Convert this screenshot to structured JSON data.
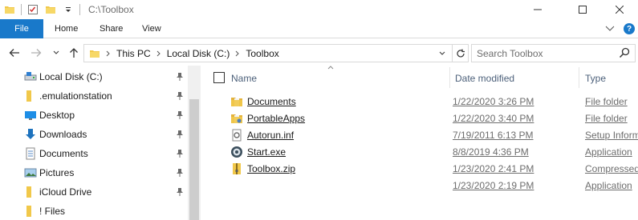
{
  "titlebar": {
    "title": "C:\\Toolbox"
  },
  "ribbon": {
    "file_tab": "File",
    "tabs": [
      "Home",
      "Share",
      "View"
    ],
    "help": "?"
  },
  "address": {
    "crumbs": [
      "This PC",
      "Local Disk (C:)",
      "Toolbox"
    ]
  },
  "search": {
    "placeholder": "Search Toolbox"
  },
  "navpane": {
    "items": [
      {
        "label": "Local Disk (C:)",
        "icon": "drive-icon",
        "pinned": true
      },
      {
        "label": ".emulationstation",
        "icon": "folder-icon",
        "pinned": true
      },
      {
        "label": "Desktop",
        "icon": "desktop-icon",
        "pinned": true
      },
      {
        "label": "Downloads",
        "icon": "downloads-icon",
        "pinned": true
      },
      {
        "label": "Documents",
        "icon": "documents-icon",
        "pinned": true
      },
      {
        "label": "Pictures",
        "icon": "pictures-icon",
        "pinned": true
      },
      {
        "label": "iCloud Drive",
        "icon": "folder-icon",
        "pinned": true
      },
      {
        "label": "! Files",
        "icon": "folder-icon",
        "pinned": false
      }
    ]
  },
  "filelist": {
    "columns": {
      "name": "Name",
      "date": "Date modified",
      "type": "Type"
    },
    "rows": [
      {
        "name": "Documents",
        "date": "1/22/2020 3:26 PM",
        "type": "File folder",
        "icon": "folder-icon"
      },
      {
        "name": "PortableApps",
        "date": "1/22/2020 3:40 PM",
        "type": "File folder",
        "icon": "folder-icon"
      },
      {
        "name": "Autorun.inf",
        "date": "7/19/2011 6:13 PM",
        "type": "Setup Inform",
        "icon": "setup-file-icon"
      },
      {
        "name": "Start.exe",
        "date": "8/8/2019 4:36 PM",
        "type": "Application",
        "icon": "app-icon"
      },
      {
        "name": "Toolbox.zip",
        "date": "1/23/2020 2:41 PM",
        "type": "Compressed",
        "icon": "zip-icon"
      },
      {
        "name": "",
        "date": "1/23/2020 2:19 PM",
        "type": "Application",
        "icon": ""
      }
    ]
  },
  "colors": {
    "accent": "#1979ca",
    "folder": "#f1c84a",
    "header_text": "#4c607a"
  }
}
